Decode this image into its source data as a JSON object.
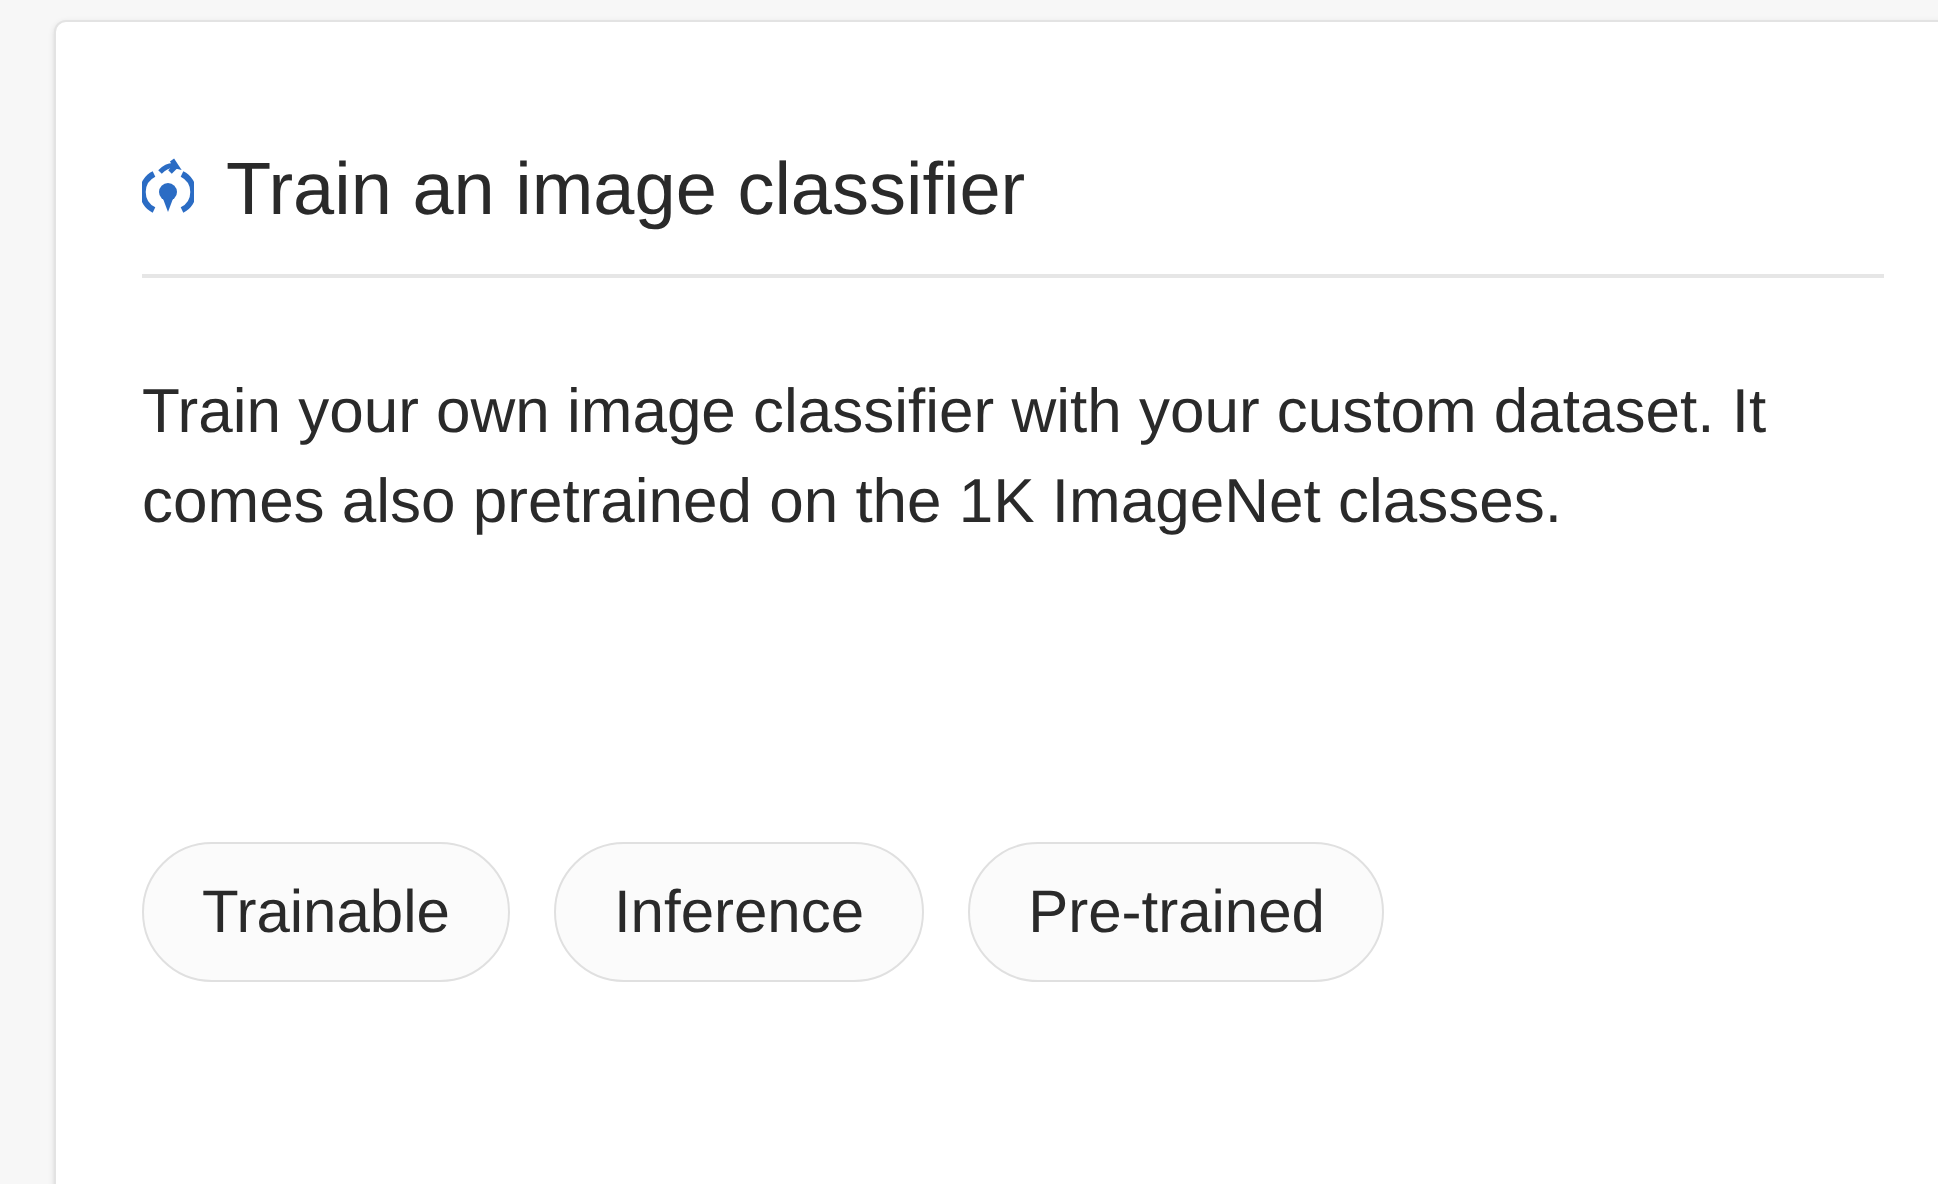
{
  "card": {
    "title": "Train an image classifier",
    "description": "Train your own image classifier with your custom dataset. It comes also pretrained on the 1K ImageNet classes.",
    "tags": [
      "Trainable",
      "Inference",
      "Pre-trained"
    ]
  }
}
